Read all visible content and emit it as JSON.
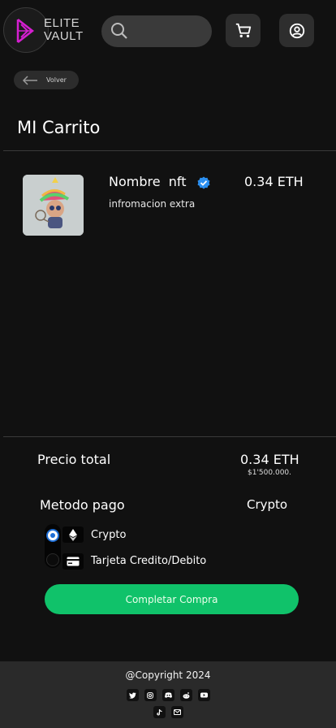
{
  "header": {
    "logo_text_line1": "ELITE",
    "logo_text_line2": "VAULT",
    "search": {
      "value": "",
      "placeholder": ""
    }
  },
  "nav": {
    "back_label": "Volver"
  },
  "page": {
    "title": "MI Carrito"
  },
  "cart": {
    "items": [
      {
        "name": "Nombre  nft",
        "extra": "infromacion extra",
        "price": "0.34 ETH",
        "verified": true
      }
    ]
  },
  "summary": {
    "total_label": "Precio total",
    "total_eth": "0.34 ETH",
    "total_fiat": "$1'500.000.",
    "method_label": "Metodo pago",
    "method_value": "Crypto",
    "options": [
      {
        "label": "Crypto",
        "selected": true,
        "icon": "ethereum-icon"
      },
      {
        "label": "Tarjeta Credito/Debito",
        "selected": false,
        "icon": "credit-card-icon"
      }
    ],
    "cta_label": "Completar Compra"
  },
  "footer": {
    "copyright": "@Copyright 2024",
    "social_icons": [
      "twitter-icon",
      "instagram-icon",
      "discord-icon",
      "reddit-icon",
      "youtube-icon",
      "tiktok-icon",
      "email-icon"
    ]
  },
  "colors": {
    "background": "#111111",
    "accent_green": "#10c26a",
    "radio_blue": "#1f6fd6",
    "logo_magenta": "#d51fd0",
    "verified_blue": "#2b8ff0",
    "footer_bg": "#2a2a2a"
  }
}
